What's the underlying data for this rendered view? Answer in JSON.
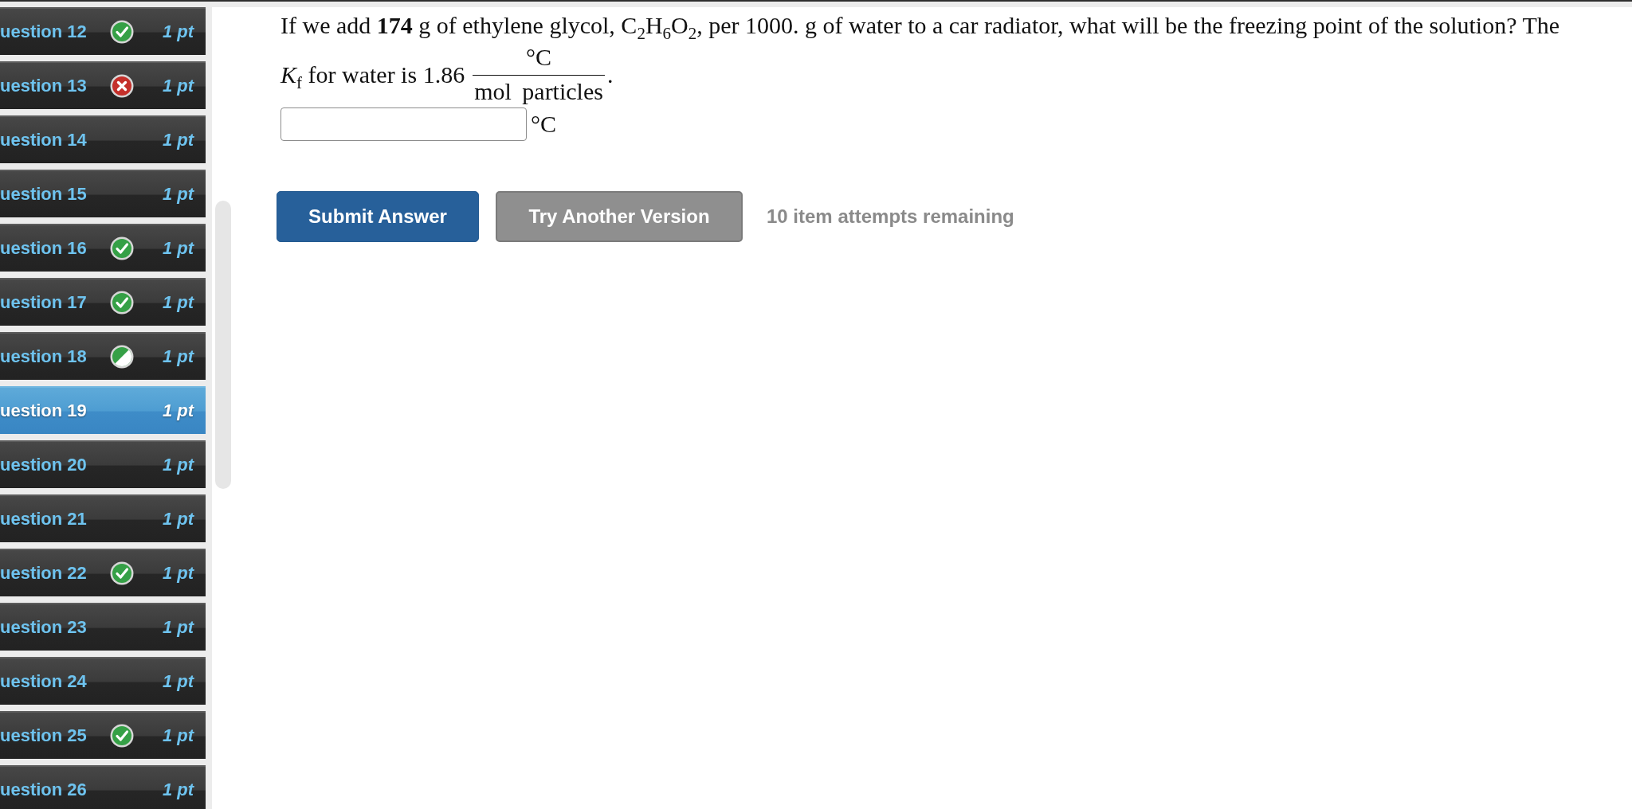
{
  "sidebar": {
    "items": [
      {
        "label": "uestion 12",
        "points": "1 pt",
        "kind": "correct",
        "selected": false
      },
      {
        "label": "uestion 13",
        "points": "1 pt",
        "kind": "incorrect",
        "selected": false
      },
      {
        "label": "uestion 14",
        "points": "1 pt",
        "kind": "plain",
        "selected": false
      },
      {
        "label": "uestion 15",
        "points": "1 pt",
        "kind": "plain",
        "selected": false
      },
      {
        "label": "uestion 16",
        "points": "1 pt",
        "kind": "correct",
        "selected": false
      },
      {
        "label": "uestion 17",
        "points": "1 pt",
        "kind": "correct",
        "selected": false
      },
      {
        "label": "uestion 18",
        "points": "1 pt",
        "kind": "partial",
        "selected": false
      },
      {
        "label": "uestion 19",
        "points": "1 pt",
        "kind": "plain",
        "selected": true
      },
      {
        "label": "uestion 20",
        "points": "1 pt",
        "kind": "plain",
        "selected": false
      },
      {
        "label": "uestion 21",
        "points": "1 pt",
        "kind": "plain",
        "selected": false
      },
      {
        "label": "uestion 22",
        "points": "1 pt",
        "kind": "correct",
        "selected": false
      },
      {
        "label": "uestion 23",
        "points": "1 pt",
        "kind": "plain",
        "selected": false
      },
      {
        "label": "uestion 24",
        "points": "1 pt",
        "kind": "plain",
        "selected": false
      },
      {
        "label": "uestion 25",
        "points": "1 pt",
        "kind": "correct",
        "selected": false
      },
      {
        "label": "uestion 26",
        "points": "1 pt",
        "kind": "plain",
        "selected": false
      }
    ]
  },
  "question": {
    "text": "If we add **174** g of ethylene glycol, C$_{2}$H$_{6}$O$_{2}$, per 1000. g of water to a car radiator, what will be the freezing point of the solution? The *K*$_{f}$ for water is 1.86",
    "unit_fraction": {
      "numerator": "°C",
      "denominator": "mol particles"
    },
    "text_end": "."
  },
  "answer": {
    "unit": "°C"
  },
  "buttons": [
    {
      "label": "Submit Answer",
      "kind": "submit"
    },
    {
      "label": "Try Another Version",
      "kind": "retry"
    }
  ],
  "attempts_note": "10 item attempts remaining"
}
